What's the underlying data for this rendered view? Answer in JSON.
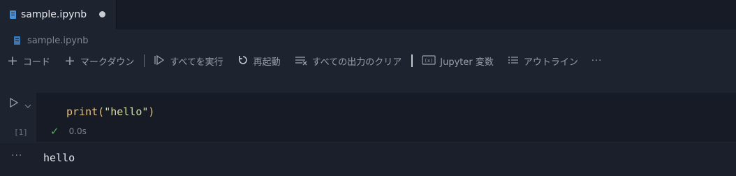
{
  "tab": {
    "label": "sample.ipynb",
    "unsaved": true
  },
  "breadcrumb": {
    "label": "sample.ipynb"
  },
  "toolbar": {
    "add_code": "コード",
    "add_markdown": "マークダウン",
    "run_all": "すべてを実行",
    "restart": "再起動",
    "clear_outputs": "すべての出力のクリア",
    "variables": "Jupyter 変数",
    "outline": "アウトライン",
    "more": "···"
  },
  "cell": {
    "code_fn": "print(",
    "code_arg": "\"hello\"",
    "code_end": ")",
    "execution_count": "[1]",
    "status": "success",
    "duration": "0.0s"
  },
  "output": {
    "text": "hello",
    "more": "···"
  },
  "colors": {
    "background": "#1e2330",
    "tabbar": "#171b25",
    "success": "#5ea96a",
    "code_function": "#e6c07b",
    "code_string": "#d8e0a8"
  },
  "icons": {
    "tab": "notebook-file-icon",
    "run_cell": "play-icon",
    "expand": "chevron-down-icon",
    "status": "check-icon"
  }
}
